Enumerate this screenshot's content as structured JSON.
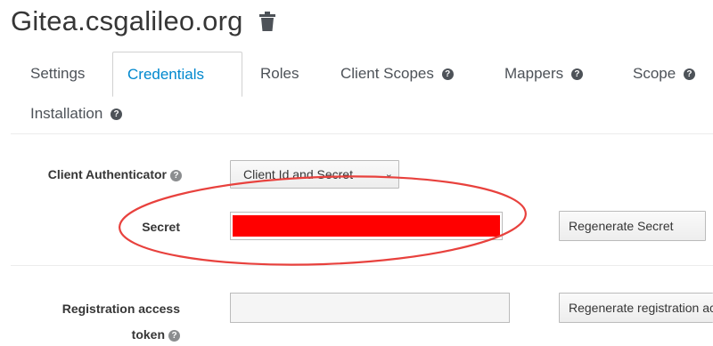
{
  "header": {
    "title": "Gitea.csgalileo.org",
    "delete_icon": "trash-icon"
  },
  "tabs": [
    {
      "label": "Settings",
      "active": false,
      "help": false
    },
    {
      "label": "Credentials",
      "active": true,
      "help": false
    },
    {
      "label": "Roles",
      "active": false,
      "help": false
    },
    {
      "label": "Client Scopes",
      "active": false,
      "help": true
    },
    {
      "label": "Mappers",
      "active": false,
      "help": true
    },
    {
      "label": "Scope",
      "active": false,
      "help": true
    },
    {
      "label": "Installation",
      "active": false,
      "help": true
    }
  ],
  "form": {
    "client_authenticator": {
      "label": "Client Authenticator",
      "value": "Client Id and Secret"
    },
    "secret": {
      "label": "Secret",
      "regenerate_label": "Regenerate Secret"
    },
    "registration_token": {
      "label_line1": "Registration access",
      "label_line2": "token",
      "regenerate_label": "Regenerate registration access token"
    }
  },
  "colors": {
    "accent": "#0088ce",
    "annotation": "#e8413d",
    "redaction": "#ff0000"
  }
}
